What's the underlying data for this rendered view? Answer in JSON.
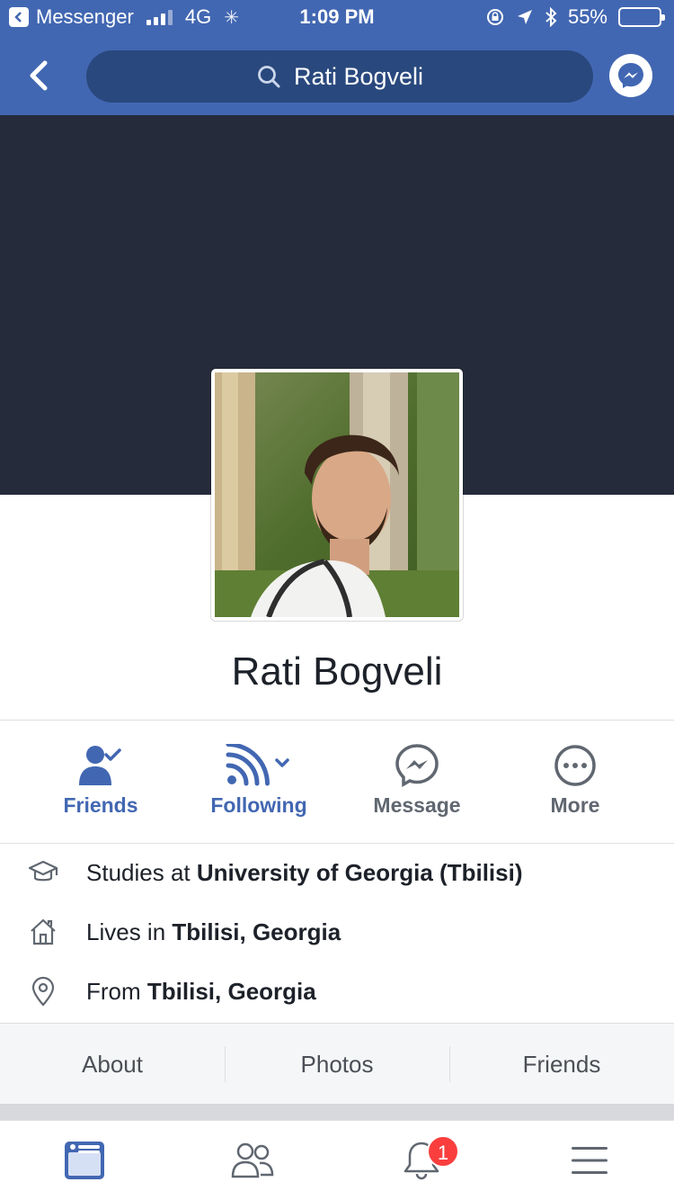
{
  "status_bar": {
    "back_app": "Messenger",
    "network": "4G",
    "time": "1:09 PM",
    "battery": "55%",
    "battery_level": 0.55
  },
  "nav": {
    "search_text": "Rati Bogveli"
  },
  "profile": {
    "name": "Rati Bogveli"
  },
  "actions": [
    {
      "label": "Friends",
      "icon": "friends-check-icon"
    },
    {
      "label": "Following",
      "icon": "following-feed-icon"
    },
    {
      "label": "Message",
      "icon": "messenger-icon"
    },
    {
      "label": "More",
      "icon": "more-dots-icon"
    }
  ],
  "info": {
    "studies_prefix": "Studies at",
    "studies_value": "University of Georgia (Tbilisi)",
    "lives_prefix": "Lives in",
    "lives_value": "Tbilisi, Georgia",
    "from_prefix": "From",
    "from_value": "Tbilisi, Georgia"
  },
  "subtabs": [
    "About",
    "Photos",
    "Friends"
  ],
  "tabbar": {
    "notifications_badge": "1"
  },
  "colors": {
    "brand": "#4267b2",
    "cover": "#252b3a",
    "badge": "#fa3e3e"
  }
}
